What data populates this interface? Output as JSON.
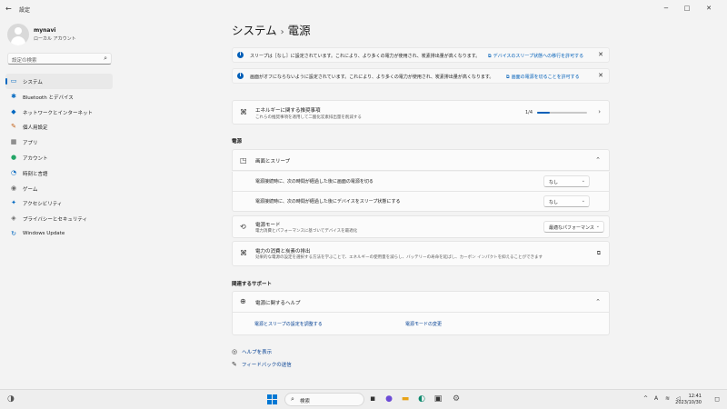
{
  "window": {
    "title": "設定",
    "back_icon": "arrow-left-icon",
    "minimize": "−",
    "maximize": "□",
    "close": "✕"
  },
  "profile": {
    "name": "mynavi",
    "type": "ローカル アカウント"
  },
  "search": {
    "placeholder": "設定の検索"
  },
  "sidebar": {
    "items": [
      {
        "label": "システム",
        "icon": "monitor-icon",
        "glyph": "▭",
        "color": "#0067c0",
        "active": true
      },
      {
        "label": "Bluetooth とデバイス",
        "icon": "bluetooth-icon",
        "glyph": "✱",
        "color": "#0067c0"
      },
      {
        "label": "ネットワークとインターネット",
        "icon": "wifi-icon",
        "glyph": "◆",
        "color": "#0067c0"
      },
      {
        "label": "個人用設定",
        "icon": "brush-icon",
        "glyph": "✎",
        "color": "#c25f16"
      },
      {
        "label": "アプリ",
        "icon": "apps-icon",
        "glyph": "▦",
        "color": "#555555"
      },
      {
        "label": "アカウント",
        "icon": "person-icon",
        "glyph": "●",
        "color": "#23a566"
      },
      {
        "label": "時刻と言語",
        "icon": "globe-clock-icon",
        "glyph": "◔",
        "color": "#0067c0"
      },
      {
        "label": "ゲーム",
        "icon": "gamepad-icon",
        "glyph": "◉",
        "color": "#6b6b6b"
      },
      {
        "label": "アクセシビリティ",
        "icon": "accessibility-icon",
        "glyph": "✦",
        "color": "#0067c0"
      },
      {
        "label": "プライバシーとセキュリティ",
        "icon": "shield-icon",
        "glyph": "◈",
        "color": "#6b6b6b"
      },
      {
        "label": "Windows Update",
        "icon": "update-icon",
        "glyph": "↻",
        "color": "#0067c0"
      }
    ]
  },
  "breadcrumb": {
    "parent": "システム",
    "separator": "›",
    "current": "電源"
  },
  "banners": [
    {
      "text": "スリープは［なし］に設定されています。これにより、より多くの電力が使用され、炭素排出量が高くなります。",
      "link": "デバイスのスリープ状態への移行を許可する"
    },
    {
      "text": "画面がオフにならないように設定されています。これにより、より多くの電力が使用され、炭素排出量が高くなります。",
      "link": "画面の電源を切ることを許可する"
    }
  ],
  "energy": {
    "title": "エネルギーに関する推奨事項",
    "subtitle": "これらの推奨事項を適用して二酸化炭素排出量を削減する",
    "progress_text": "1/4",
    "progress_fraction": 0.25
  },
  "power_section": {
    "label": "電源",
    "screen_sleep": {
      "title": "画面とスリープ",
      "rows": [
        {
          "label": "電源接続時に、次の時間が経過した後に画面の電源を切る",
          "value": "なし"
        },
        {
          "label": "電源接続時に、次の時間が経過した後にデバイスをスリープ状態にする",
          "value": "なし"
        }
      ]
    },
    "power_mode": {
      "title": "電源モード",
      "subtitle": "電力消費とパフォーマンスに基づいてデバイスを最適化",
      "value": "最適なパフォーマンス"
    },
    "power_usage": {
      "title": "電力の消費と炭素の排出",
      "subtitle": "効果的な電源の設定を選択する方法を学ぶことで、エネルギーの使用量を減らし、バッテリーの寿命を延ばし、カーボン インパクトを抑えることができます"
    }
  },
  "support_section": {
    "label": "関連するサポート",
    "help": {
      "title": "電源に関するヘルプ",
      "links": [
        "電源とスリープの設定を調整する",
        "電源モードの変更"
      ]
    }
  },
  "footer": {
    "get_help": "ヘルプを表示",
    "feedback": "フィードバックの送信"
  },
  "taskbar": {
    "search_label": "検索",
    "time": "12:41",
    "date": "2023/10/30",
    "tray_up": "^",
    "lang": "A"
  }
}
